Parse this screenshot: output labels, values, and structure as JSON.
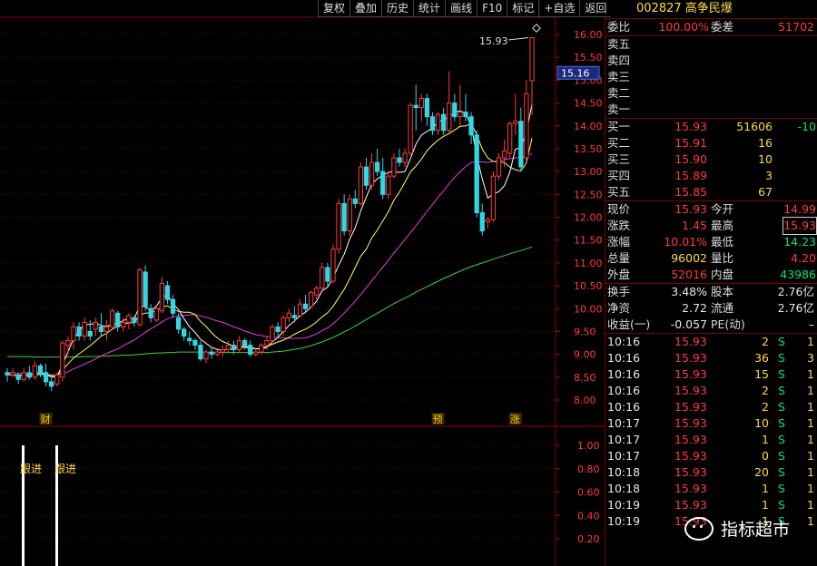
{
  "toolbar": [
    "复权",
    "叠加",
    "历史",
    "统计",
    "画线",
    "F10",
    "标记",
    "+自选",
    "返回"
  ],
  "stock": {
    "code": "002827",
    "name": "高争民爆"
  },
  "quote": {
    "weibi_label": "委比",
    "weibi": "100.00%",
    "weicha_label": "委差",
    "weicha": "51702",
    "sell": [
      {
        "label": "卖五"
      },
      {
        "label": "卖四"
      },
      {
        "label": "卖三"
      },
      {
        "label": "卖二"
      },
      {
        "label": "卖一"
      }
    ],
    "buy": [
      {
        "label": "买一",
        "price": "15.93",
        "vol": "51606",
        "chg": "-10"
      },
      {
        "label": "买二",
        "price": "15.91",
        "vol": "16",
        "chg": ""
      },
      {
        "label": "买三",
        "price": "15.90",
        "vol": "10",
        "chg": ""
      },
      {
        "label": "买四",
        "price": "15.89",
        "vol": "3",
        "chg": ""
      },
      {
        "label": "买五",
        "price": "15.85",
        "vol": "67",
        "chg": ""
      }
    ],
    "stats": [
      {
        "l1": "现价",
        "v1": "15.93",
        "l2": "今开",
        "v2": "14.99"
      },
      {
        "l1": "涨跌",
        "v1": "1.45",
        "l2": "最高",
        "v2": "15.93"
      },
      {
        "l1": "涨幅",
        "v1": "10.01%",
        "l2": "最低",
        "v2": "14.23"
      },
      {
        "l1": "总量",
        "v1": "96002",
        "l2": "量比",
        "v2": "4.20"
      },
      {
        "l1": "外盘",
        "v1": "52016",
        "l2": "内盘",
        "v2": "43986"
      }
    ],
    "info": [
      {
        "l1": "换手",
        "v1": "3.48%",
        "l2": "股本",
        "v2": "2.76亿"
      },
      {
        "l1": "净资",
        "v1": "2.72",
        "l2": "流通",
        "v2": "2.76亿"
      },
      {
        "l1": "收益(一)",
        "v1": "-0.057",
        "l2": "PE(动)",
        "v2": "–"
      }
    ]
  },
  "ticks": [
    {
      "time": "10:16",
      "price": "15.93",
      "vol": "2",
      "side": "S",
      "n": "1"
    },
    {
      "time": "10:16",
      "price": "15.93",
      "vol": "36",
      "side": "S",
      "n": "3"
    },
    {
      "time": "10:16",
      "price": "15.93",
      "vol": "15",
      "side": "S",
      "n": "1"
    },
    {
      "time": "10:16",
      "price": "15.93",
      "vol": "2",
      "side": "S",
      "n": "1"
    },
    {
      "time": "10:16",
      "price": "15.93",
      "vol": "2",
      "side": "S",
      "n": "1"
    },
    {
      "time": "10:17",
      "price": "15.93",
      "vol": "10",
      "side": "S",
      "n": "1"
    },
    {
      "time": "10:17",
      "price": "15.93",
      "vol": "1",
      "side": "S",
      "n": "1"
    },
    {
      "time": "10:17",
      "price": "15.93",
      "vol": "0",
      "side": "S",
      "n": "1"
    },
    {
      "time": "10:18",
      "price": "15.93",
      "vol": "20",
      "side": "S",
      "n": "1"
    },
    {
      "time": "10:18",
      "price": "15.93",
      "vol": "1",
      "side": "S",
      "n": "1"
    },
    {
      "time": "10:19",
      "price": "15.93",
      "vol": "1",
      "side": "S",
      "n": "1"
    },
    {
      "time": "10:19",
      "price": "15.93",
      "vol": "1",
      "side": "S",
      "n": "1"
    }
  ],
  "chart": {
    "price_axis": [
      "16.00",
      "15.50",
      "15.00",
      "14.50",
      "14.00",
      "13.50",
      "13.00",
      "12.50",
      "12.00",
      "11.50",
      "11.00",
      "10.50",
      "10.00",
      "9.50",
      "9.00",
      "8.50",
      "8.00"
    ],
    "current_price_tag": "15.16",
    "high_callout": "15.93",
    "markers": [
      {
        "text": "财",
        "day": 7
      },
      {
        "text": "预",
        "day": 78
      },
      {
        "text": "涨",
        "day": 92
      }
    ],
    "sub_axis": [
      "1.00",
      "0.80",
      "0.60",
      "0.40",
      "0.20"
    ],
    "signal_label": "跟进",
    "colors": {
      "up": "#ff3b3b",
      "down": "#32d7e6",
      "ma5": "#ffffff",
      "ma10": "#ffff66",
      "ma20": "#e040e0",
      "ma60": "#40d040"
    }
  },
  "chart_data": {
    "type": "candlestick",
    "ylim": [
      7.8,
      16.2
    ],
    "candles": [
      [
        8.6,
        8.7,
        8.4,
        8.55
      ],
      [
        8.55,
        8.7,
        8.5,
        8.6
      ],
      [
        8.55,
        8.6,
        8.35,
        8.45
      ],
      [
        8.45,
        8.7,
        8.4,
        8.6
      ],
      [
        8.6,
        8.75,
        8.45,
        8.5
      ],
      [
        8.5,
        8.85,
        8.45,
        8.75
      ],
      [
        8.75,
        8.8,
        8.5,
        8.55
      ],
      [
        8.6,
        8.8,
        8.3,
        8.4
      ],
      [
        8.4,
        8.55,
        8.2,
        8.3
      ],
      [
        8.35,
        8.6,
        8.3,
        8.55
      ],
      [
        8.5,
        9.3,
        8.4,
        9.25
      ],
      [
        9.2,
        9.4,
        9.0,
        9.3
      ],
      [
        9.3,
        9.7,
        9.1,
        9.6
      ],
      [
        9.6,
        9.7,
        9.3,
        9.4
      ],
      [
        9.4,
        9.8,
        9.3,
        9.7
      ],
      [
        9.5,
        9.75,
        9.3,
        9.4
      ],
      [
        9.55,
        9.8,
        9.4,
        9.7
      ],
      [
        9.6,
        9.9,
        9.4,
        9.5
      ],
      [
        9.5,
        9.75,
        9.3,
        9.6
      ],
      [
        9.6,
        10.0,
        9.6,
        9.95
      ],
      [
        9.9,
        9.95,
        9.5,
        9.6
      ],
      [
        9.6,
        9.8,
        9.5,
        9.7
      ],
      [
        9.7,
        9.9,
        9.55,
        9.85
      ],
      [
        9.8,
        9.85,
        9.6,
        9.7
      ],
      [
        9.65,
        10.9,
        9.6,
        10.85
      ],
      [
        10.8,
        10.95,
        9.95,
        10.05
      ],
      [
        10.0,
        10.1,
        9.7,
        9.8
      ],
      [
        9.75,
        10.05,
        9.7,
        10.0
      ],
      [
        9.95,
        10.7,
        9.9,
        10.55
      ],
      [
        10.5,
        10.6,
        10.1,
        10.2
      ],
      [
        10.2,
        10.3,
        9.8,
        9.9
      ],
      [
        9.8,
        9.9,
        9.45,
        9.55
      ],
      [
        9.55,
        9.6,
        9.3,
        9.4
      ],
      [
        9.35,
        9.5,
        9.2,
        9.3
      ],
      [
        9.3,
        9.35,
        9.1,
        9.2
      ],
      [
        9.2,
        9.3,
        8.85,
        8.9
      ],
      [
        8.9,
        9.1,
        8.8,
        9.05
      ],
      [
        9.05,
        9.15,
        8.9,
        9.0
      ],
      [
        9.0,
        9.1,
        8.95,
        9.05
      ],
      [
        9.05,
        9.2,
        8.95,
        9.1
      ],
      [
        9.1,
        9.3,
        9.05,
        9.2
      ],
      [
        9.2,
        9.3,
        9.0,
        9.1
      ],
      [
        9.1,
        9.4,
        9.05,
        9.3
      ],
      [
        9.3,
        9.35,
        9.1,
        9.2
      ],
      [
        9.2,
        9.3,
        8.95,
        9.0
      ],
      [
        9.0,
        9.1,
        8.95,
        9.05
      ],
      [
        9.05,
        9.25,
        9.0,
        9.2
      ],
      [
        9.2,
        9.4,
        9.1,
        9.3
      ],
      [
        9.3,
        9.65,
        9.25,
        9.6
      ],
      [
        9.6,
        9.7,
        9.4,
        9.5
      ],
      [
        9.5,
        9.85,
        9.4,
        9.8
      ],
      [
        9.8,
        10.0,
        9.7,
        9.9
      ],
      [
        9.85,
        10.05,
        9.7,
        9.8
      ],
      [
        9.85,
        10.2,
        9.8,
        10.1
      ],
      [
        10.1,
        10.3,
        9.9,
        10.0
      ],
      [
        10.05,
        10.4,
        10.0,
        10.35
      ],
      [
        10.3,
        10.5,
        10.2,
        10.45
      ],
      [
        10.45,
        11.0,
        10.4,
        10.9
      ],
      [
        10.9,
        11.0,
        10.5,
        10.6
      ],
      [
        10.6,
        11.4,
        10.55,
        11.3
      ],
      [
        11.3,
        12.4,
        11.2,
        12.3
      ],
      [
        12.3,
        12.5,
        11.6,
        11.7
      ],
      [
        11.7,
        12.5,
        11.6,
        12.4
      ],
      [
        12.4,
        12.6,
        12.2,
        12.3
      ],
      [
        12.3,
        13.2,
        12.25,
        13.1
      ],
      [
        13.1,
        13.3,
        12.6,
        12.7
      ],
      [
        12.7,
        13.4,
        12.6,
        13.2
      ],
      [
        13.2,
        13.5,
        12.9,
        13.0
      ],
      [
        13.0,
        13.3,
        12.4,
        12.5
      ],
      [
        12.5,
        13.0,
        12.4,
        12.9
      ],
      [
        12.9,
        13.4,
        12.85,
        13.3
      ],
      [
        13.3,
        13.5,
        13.1,
        13.2
      ],
      [
        13.2,
        13.5,
        13.1,
        13.4
      ],
      [
        13.4,
        14.5,
        13.35,
        14.45
      ],
      [
        14.45,
        14.9,
        13.9,
        14.4
      ],
      [
        14.4,
        14.7,
        14.1,
        14.6
      ],
      [
        14.6,
        14.7,
        14.0,
        14.2
      ],
      [
        14.2,
        14.3,
        13.8,
        13.9
      ],
      [
        13.9,
        14.3,
        13.8,
        14.25
      ],
      [
        14.25,
        14.4,
        13.8,
        13.9
      ],
      [
        13.9,
        15.2,
        13.85,
        14.5
      ],
      [
        14.5,
        14.7,
        14.1,
        14.2
      ],
      [
        14.2,
        14.9,
        14.0,
        14.3
      ],
      [
        14.3,
        14.7,
        14.1,
        14.2
      ],
      [
        14.2,
        14.3,
        13.6,
        13.8
      ],
      [
        13.8,
        13.9,
        12.0,
        12.1
      ],
      [
        12.1,
        12.3,
        11.6,
        11.7
      ],
      [
        11.9,
        12.0,
        11.75,
        11.95
      ],
      [
        11.95,
        13.0,
        11.9,
        12.9
      ],
      [
        12.9,
        13.4,
        12.8,
        13.3
      ],
      [
        13.3,
        13.7,
        13.1,
        13.45
      ],
      [
        13.4,
        14.1,
        13.3,
        14.05
      ],
      [
        14.05,
        14.7,
        13.8,
        14.1
      ],
      [
        14.1,
        14.4,
        13.0,
        13.1
      ],
      [
        13.3,
        15.0,
        13.2,
        14.7
      ],
      [
        14.99,
        15.93,
        14.23,
        15.93
      ]
    ],
    "ma5": [
      8.55,
      8.55,
      8.52,
      8.55,
      8.54,
      8.58,
      8.6,
      8.56,
      8.5,
      8.51,
      8.77,
      9.05,
      9.35,
      9.5,
      9.66,
      9.65,
      9.69,
      9.63,
      9.61,
      9.66,
      9.67,
      9.74,
      9.78,
      9.78,
      10.06,
      10.04,
      9.96,
      10.05,
      10.25,
      10.3,
      10.11,
      9.98,
      9.78,
      9.6,
      9.48,
      9.33,
      9.24,
      9.15,
      9.11,
      9.08,
      9.12,
      9.11,
      9.16,
      9.18,
      9.16,
      9.12,
      9.12,
      9.15,
      9.27,
      9.37,
      9.5,
      9.63,
      9.73,
      9.85,
      9.92,
      10.03,
      10.16,
      10.39,
      10.47,
      10.67,
      10.95,
      11.19,
      11.52,
      11.77,
      12.14,
      12.44,
      12.73,
      12.84,
      12.92,
      12.98,
      13.0,
      12.98,
      13.0,
      13.28,
      13.6,
      13.8,
      13.88,
      13.95,
      14.09,
      14.13,
      14.19,
      14.3,
      14.33,
      14.27,
      14.0,
      13.34,
      12.85,
      12.42,
      12.51,
      12.56,
      12.69,
      12.99,
      13.49,
      13.52,
      13.85,
      14.48
    ],
    "ma10": [
      8.55,
      8.55,
      8.53,
      8.55,
      8.55,
      8.56,
      8.56,
      8.55,
      8.53,
      8.53,
      8.66,
      8.79,
      8.92,
      9.01,
      9.1,
      9.19,
      9.29,
      9.4,
      9.46,
      9.55,
      9.62,
      9.66,
      9.69,
      9.69,
      9.86,
      9.9,
      9.91,
      9.96,
      10.03,
      10.06,
      9.99,
      9.94,
      9.92,
      9.92,
      9.87,
      9.72,
      9.61,
      9.47,
      9.36,
      9.28,
      9.23,
      9.18,
      9.16,
      9.15,
      9.14,
      9.12,
      9.14,
      9.17,
      9.22,
      9.27,
      9.31,
      9.37,
      9.44,
      9.5,
      9.55,
      9.62,
      9.71,
      9.82,
      9.91,
      10.05,
      10.24,
      10.42,
      10.65,
      10.9,
      11.15,
      11.3,
      11.55,
      11.72,
      11.92,
      12.12,
      12.37,
      12.55,
      12.77,
      12.99,
      13.12,
      13.27,
      13.46,
      13.58,
      13.69,
      13.77,
      13.83,
      13.91,
      13.99,
      14.0,
      14.05,
      13.81,
      13.49,
      13.3,
      13.22,
      13.21,
      13.2,
      13.1,
      13.04,
      13.01,
      13.19,
      13.73
    ],
    "ma20": [
      8.6,
      8.59,
      8.58,
      8.57,
      8.57,
      8.56,
      8.56,
      8.56,
      8.55,
      8.55,
      8.58,
      8.62,
      8.68,
      8.73,
      8.79,
      8.84,
      8.9,
      8.96,
      9.02,
      9.07,
      9.12,
      9.19,
      9.25,
      9.31,
      9.4,
      9.48,
      9.56,
      9.63,
      9.71,
      9.78,
      9.82,
      9.84,
      9.85,
      9.86,
      9.87,
      9.84,
      9.81,
      9.77,
      9.73,
      9.7,
      9.65,
      9.6,
      9.56,
      9.51,
      9.47,
      9.43,
      9.41,
      9.39,
      9.38,
      9.37,
      9.36,
      9.35,
      9.35,
      9.35,
      9.36,
      9.4,
      9.45,
      9.52,
      9.58,
      9.67,
      9.78,
      9.9,
      10.03,
      10.16,
      10.31,
      10.46,
      10.61,
      10.76,
      10.91,
      11.06,
      11.22,
      11.36,
      11.51,
      11.66,
      11.81,
      11.97,
      12.13,
      12.28,
      12.44,
      12.58,
      12.73,
      12.87,
      13.0,
      13.11,
      13.2,
      13.21,
      13.21,
      13.2,
      13.22,
      13.23,
      13.26,
      13.28,
      13.3,
      13.31,
      13.33,
      13.4
    ],
    "ma60": [
      8.95,
      8.95,
      8.95,
      8.95,
      8.95,
      8.94,
      8.94,
      8.94,
      8.94,
      8.94,
      8.94,
      8.94,
      8.94,
      8.94,
      8.95,
      8.95,
      8.95,
      8.96,
      8.96,
      8.97,
      8.97,
      8.98,
      8.98,
      8.99,
      9.0,
      9.01,
      9.02,
      9.03,
      9.03,
      9.04,
      9.04,
      9.05,
      9.05,
      9.05,
      9.05,
      9.05,
      9.05,
      9.04,
      9.04,
      9.04,
      9.04,
      9.04,
      9.04,
      9.04,
      9.04,
      9.04,
      9.04,
      9.04,
      9.05,
      9.06,
      9.07,
      9.09,
      9.11,
      9.13,
      9.16,
      9.19,
      9.23,
      9.27,
      9.32,
      9.37,
      9.43,
      9.49,
      9.55,
      9.62,
      9.69,
      9.76,
      9.83,
      9.9,
      9.97,
      10.04,
      10.11,
      10.17,
      10.23,
      10.29,
      10.36,
      10.42,
      10.48,
      10.54,
      10.6,
      10.66,
      10.71,
      10.77,
      10.82,
      10.87,
      10.92,
      10.96,
      11.0,
      11.04,
      11.08,
      11.12,
      11.16,
      11.2,
      11.24,
      11.27,
      11.31,
      11.35
    ],
    "signal_days": [
      1,
      6
    ]
  }
}
